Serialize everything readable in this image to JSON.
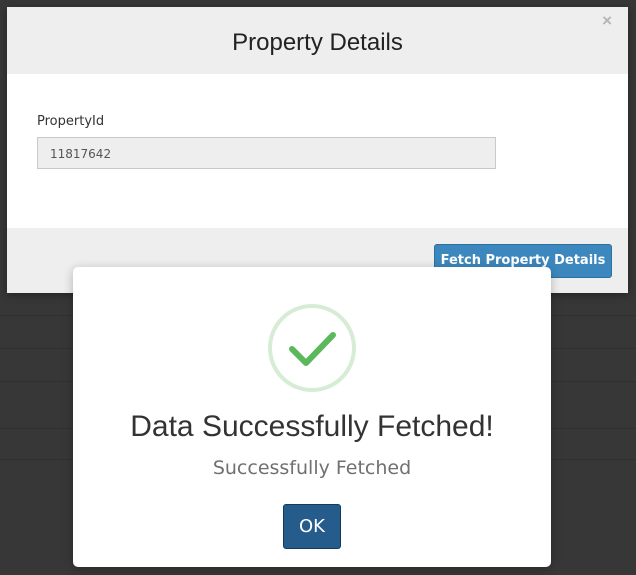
{
  "modal": {
    "title": "Property Details",
    "close_symbol": "×",
    "field_label": "PropertyId",
    "field_value": "11817642",
    "fetch_button_label": "Fetch Property Details"
  },
  "alert": {
    "icon": "checkmark-icon",
    "title": "Data Successfully Fetched!",
    "text": "Successfully Fetched",
    "ok_button_label": "OK"
  },
  "colors": {
    "fetch_button": "#3c87bd",
    "ok_button": "#255c8c",
    "success_green": "#5cb85c",
    "success_ring": "#d6ecd4"
  }
}
